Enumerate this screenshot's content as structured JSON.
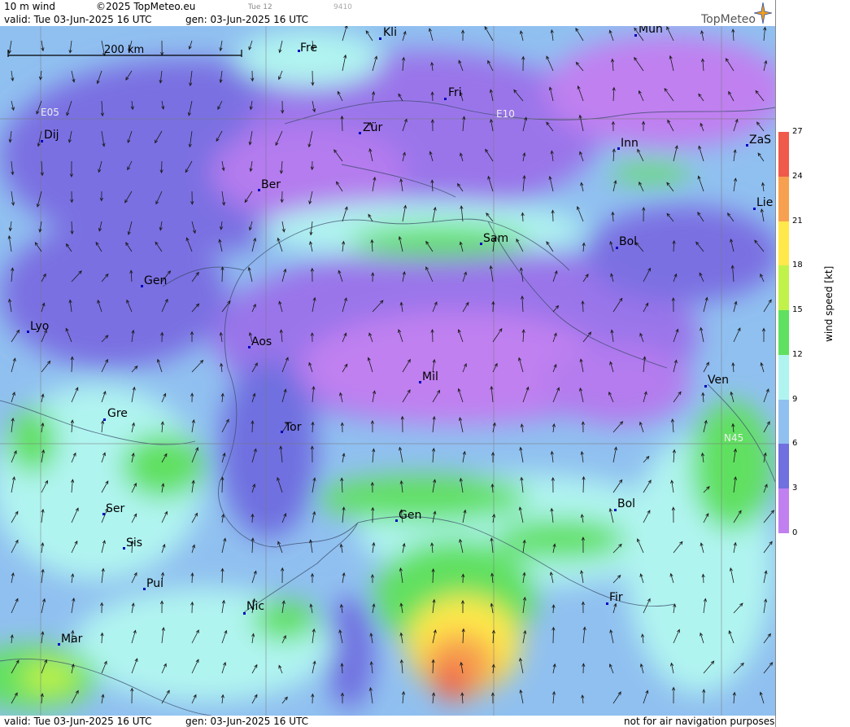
{
  "header": {
    "product": "10 m wind",
    "copyright": "©2025 TopMeteo.eu",
    "small_time": "Tue 12",
    "small_code": "9410",
    "valid_line": "valid:  Tue  03-Jun-2025  16 UTC",
    "gen_line": "gen: 03-Jun-2025 16 UTC",
    "brand": "TopMeteo"
  },
  "footer": {
    "valid_line": "valid:  Tue  03-Jun-2025  16 UTC",
    "gen_line": "gen: 03-Jun-2025 16 UTC",
    "disclaimer": "not for air navigation purposes"
  },
  "map": {
    "scale_label": "200 km",
    "grid_labels": [
      "E05",
      "E10",
      "N45"
    ],
    "cities": [
      {
        "name": "Fre"
      },
      {
        "name": "Kli"
      },
      {
        "name": "Mün"
      },
      {
        "name": "Fri"
      },
      {
        "name": "Dij"
      },
      {
        "name": "Zür"
      },
      {
        "name": "Inn"
      },
      {
        "name": "ZaS"
      },
      {
        "name": "Ber"
      },
      {
        "name": "Lie"
      },
      {
        "name": "Sam"
      },
      {
        "name": "Bol"
      },
      {
        "name": "Gen"
      },
      {
        "name": "Lyo"
      },
      {
        "name": "Aos"
      },
      {
        "name": "Mil"
      },
      {
        "name": "Ven"
      },
      {
        "name": "Gre"
      },
      {
        "name": "Tor"
      },
      {
        "name": "Ser"
      },
      {
        "name": "Gen"
      },
      {
        "name": "Bol"
      },
      {
        "name": "Sis"
      },
      {
        "name": "Pui"
      },
      {
        "name": "Nic"
      },
      {
        "name": "Fir"
      },
      {
        "name": "Mar"
      }
    ]
  },
  "legend": {
    "unit_label": "wind speed [kt]",
    "ticks": [
      "27",
      "24",
      "21",
      "18",
      "15",
      "12",
      "9",
      "6",
      "3",
      "0"
    ],
    "colors": [
      "#f05a4a",
      "#f7a050",
      "#ffe84a",
      "#c0f24a",
      "#60e060",
      "#b0f4f0",
      "#90c0f0",
      "#7070e0",
      "#c080f0"
    ]
  }
}
